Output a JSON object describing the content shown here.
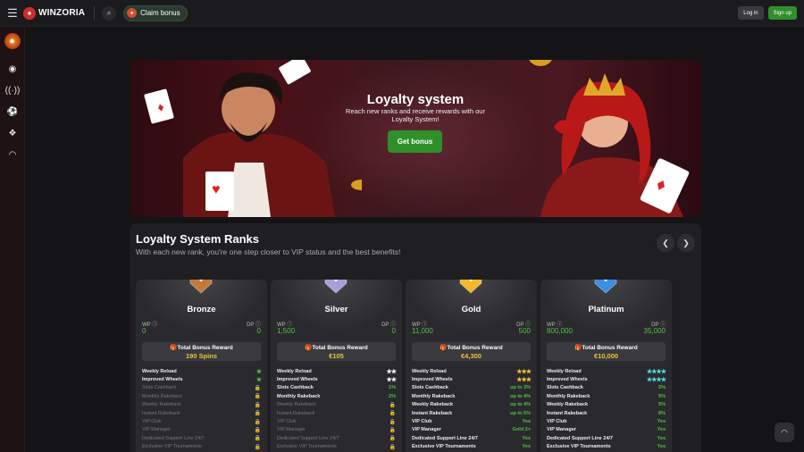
{
  "header": {
    "brand": "WINZORIA",
    "claim_bonus": "Claim bonus",
    "login": "Log in",
    "signup": "Sign up"
  },
  "sidebar": {
    "items": [
      "casino-icon",
      "soccer-icon",
      "live-icon",
      "ball-icon",
      "chip-icon",
      "support-icon"
    ]
  },
  "hero": {
    "title": "Loyalty system",
    "subtitle": "Reach new ranks and receive rewards with our Loyalty System!",
    "button": "Get bonus"
  },
  "ranks": {
    "title": "Loyalty System Ranks",
    "subtitle": "With each new rank, you're one step closer to VIP status and the best benefits!",
    "cards": [
      {
        "name": "Bronze",
        "wp_label": "WP",
        "dp_label": "DP",
        "wp": "0",
        "dp": "0",
        "reward_label": "Total Bonus Reward",
        "reward": "190 Spins",
        "color": "#c07a3a",
        "star_color": "#4fc23c",
        "features": [
          {
            "label": "Weekly Reload",
            "value": "★",
            "type": "star",
            "on": true
          },
          {
            "label": "Improved Wheels",
            "value": "★",
            "type": "star",
            "on": true
          },
          {
            "label": "Slots Cashback",
            "value": "🔒",
            "type": "lock",
            "on": false
          },
          {
            "label": "Monthly Rakeback",
            "value": "🔒",
            "type": "lock",
            "on": false
          },
          {
            "label": "Weekly Rakeback",
            "value": "🔒",
            "type": "lock",
            "on": false
          },
          {
            "label": "Instant Rakeback",
            "value": "🔒",
            "type": "lock",
            "on": false
          },
          {
            "label": "VIP Club",
            "value": "🔒",
            "type": "lock",
            "on": false
          },
          {
            "label": "VIP Manager",
            "value": "🔒",
            "type": "lock",
            "on": false
          },
          {
            "label": "Dedicated Support Line 24/7",
            "value": "🔒",
            "type": "lock",
            "on": false
          },
          {
            "label": "Exclusive VIP Tournaments",
            "value": "🔒",
            "type": "lock",
            "on": false
          }
        ]
      },
      {
        "name": "Silver",
        "wp_label": "WP",
        "dp_label": "DP",
        "wp": "1,500",
        "dp": "0",
        "reward_label": "Total Bonus Reward",
        "reward": "€105",
        "color": "#a7a0d8",
        "star_color": "#ffffff",
        "features": [
          {
            "label": "Weekly Reload",
            "value": "★★",
            "type": "star",
            "on": true
          },
          {
            "label": "Improved Wheels",
            "value": "★★",
            "type": "star",
            "on": true
          },
          {
            "label": "Slots Cashback",
            "value": "1%",
            "type": "green",
            "on": true
          },
          {
            "label": "Monthly Rakeback",
            "value": "2%",
            "type": "green",
            "on": true
          },
          {
            "label": "Weekly Rakeback",
            "value": "🔒",
            "type": "lock",
            "on": false
          },
          {
            "label": "Instant Rakeback",
            "value": "🔒",
            "type": "lock",
            "on": false
          },
          {
            "label": "VIP Club",
            "value": "🔒",
            "type": "lock",
            "on": false
          },
          {
            "label": "VIP Manager",
            "value": "🔒",
            "type": "lock",
            "on": false
          },
          {
            "label": "Dedicated Support Line 24/7",
            "value": "🔒",
            "type": "lock",
            "on": false
          },
          {
            "label": "Exclusive VIP Tournaments",
            "value": "🔒",
            "type": "lock",
            "on": false
          }
        ]
      },
      {
        "name": "Gold",
        "wp_label": "WP",
        "dp_label": "DP",
        "wp": "11,000",
        "dp": "500",
        "reward_label": "Total Bonus Reward",
        "reward": "€4,300",
        "color": "#f0b82a",
        "star_color": "#f0c23a",
        "features": [
          {
            "label": "Weekly Reload",
            "value": "★★★",
            "type": "star",
            "on": true
          },
          {
            "label": "Improved Wheels",
            "value": "★★★",
            "type": "star",
            "on": true
          },
          {
            "label": "Slots Cashback",
            "value": "up to 3%",
            "type": "green",
            "on": true
          },
          {
            "label": "Monthly Rakeback",
            "value": "up to 4%",
            "type": "green",
            "on": true
          },
          {
            "label": "Weekly Rakeback",
            "value": "up to 4%",
            "type": "green",
            "on": true
          },
          {
            "label": "Instant Rakeback",
            "value": "up to 5%",
            "type": "green",
            "on": true
          },
          {
            "label": "VIP Club",
            "value": "Yes",
            "type": "green",
            "on": true
          },
          {
            "label": "VIP Manager",
            "value": "Gold 2+",
            "type": "green",
            "on": true
          },
          {
            "label": "Dedicated Support Line 24/7",
            "value": "Yes",
            "type": "green",
            "on": true
          },
          {
            "label": "Exclusive VIP Tournaments",
            "value": "Yes",
            "type": "green",
            "on": true
          }
        ]
      },
      {
        "name": "Platinum",
        "wp_label": "WP",
        "dp_label": "DP",
        "wp": "800,000",
        "dp": "35,000",
        "reward_label": "Total Bonus Reward",
        "reward": "€10,000",
        "color": "#3a8fe0",
        "star_color": "#4fe0e0",
        "features": [
          {
            "label": "Weekly Reload",
            "value": "★★★★",
            "type": "star",
            "on": true
          },
          {
            "label": "Improved Wheels",
            "value": "★★★★",
            "type": "star",
            "on": true
          },
          {
            "label": "Slots Cashback",
            "value": "5%",
            "type": "green",
            "on": true
          },
          {
            "label": "Monthly Rakeback",
            "value": "5%",
            "type": "green",
            "on": true
          },
          {
            "label": "Weekly Rakeback",
            "value": "5%",
            "type": "green",
            "on": true
          },
          {
            "label": "Instant Rakeback",
            "value": "8%",
            "type": "green",
            "on": true
          },
          {
            "label": "VIP Club",
            "value": "Yes",
            "type": "green",
            "on": true
          },
          {
            "label": "VIP Manager",
            "value": "Yes",
            "type": "green",
            "on": true
          },
          {
            "label": "Dedicated Support Line 24/7",
            "value": "Yes",
            "type": "green",
            "on": true
          },
          {
            "label": "Exclusive VIP Tournaments",
            "value": "Yes",
            "type": "green",
            "on": true
          }
        ]
      }
    ]
  }
}
